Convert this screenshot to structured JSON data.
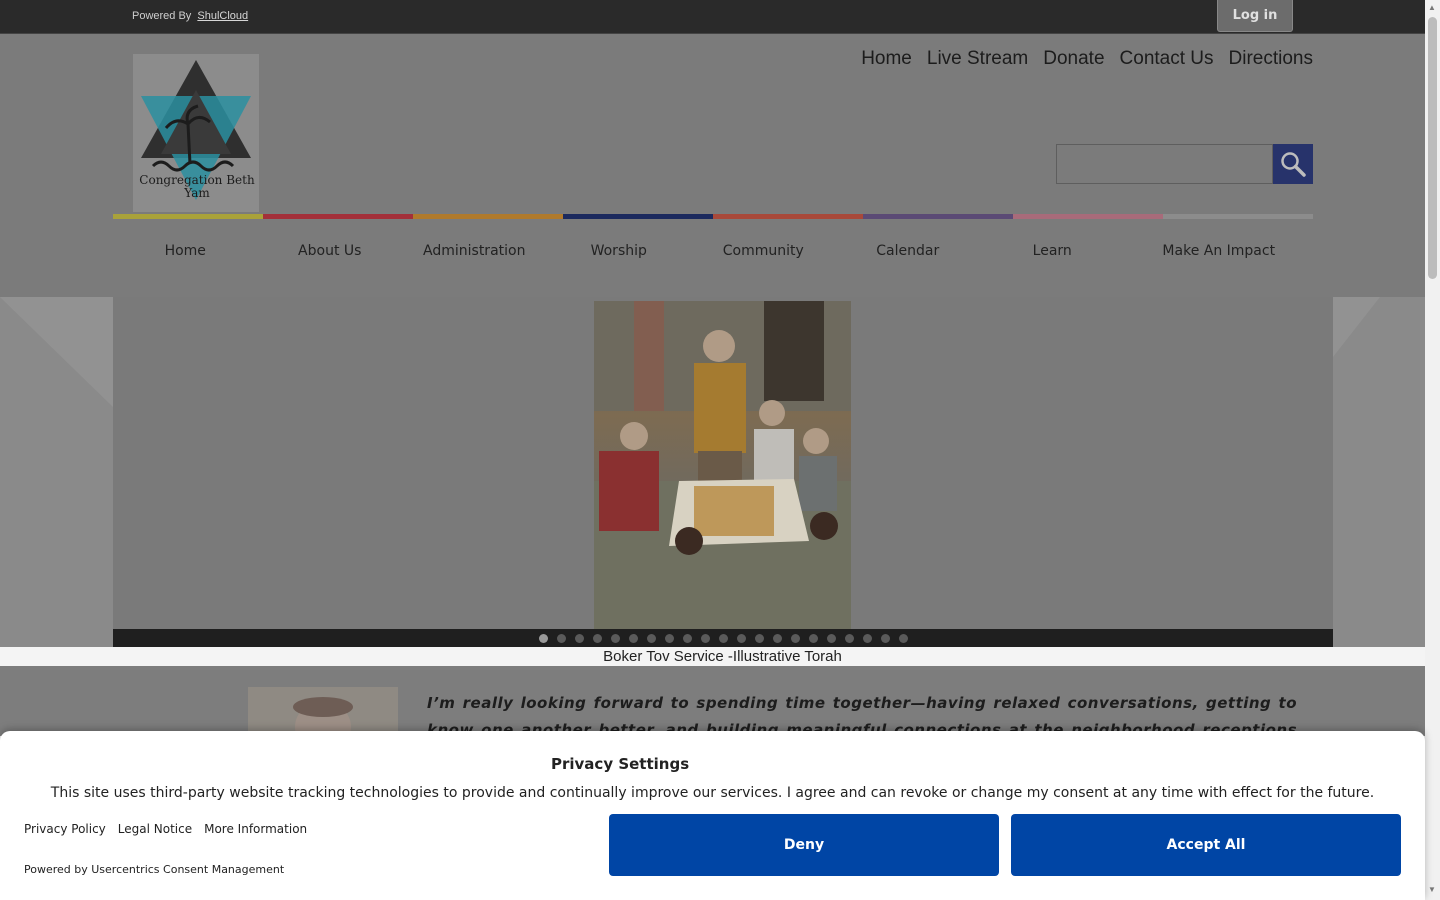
{
  "topbar": {
    "powered_prefix": "Powered By",
    "powered_link": "ShulCloud",
    "login_label": "Log in"
  },
  "logo": {
    "text": "Congregation Beth Yam"
  },
  "toplinks": [
    "Home",
    "Live Stream",
    "Donate",
    "Contact Us",
    "Directions"
  ],
  "search": {
    "placeholder": "",
    "icon": "search-icon"
  },
  "colorbar": [
    "#a9a23a",
    "#a3303a",
    "#b07a2c",
    "#1c2a5e",
    "#a8493a",
    "#5b4a75",
    "#a86b7a",
    "#8c8c8c"
  ],
  "mainnav": [
    "Home",
    "About Us",
    "Administration",
    "Worship",
    "Community",
    "Calendar",
    "Learn",
    "Make An Impact"
  ],
  "slider": {
    "caption": "Boker Tov Service -Illustrative Torah",
    "dot_count": 21,
    "active_dot": 0
  },
  "content": {
    "quote": "I’m really looking forward to spending time together—having relaxed conversations, getting to know one another better, and building meaningful connections at the neighborhood receptions our congregants are so"
  },
  "privacy": {
    "title": "Privacy Settings",
    "text": "This site uses third-party website tracking technologies to provide and continually improve our services. I agree and can revoke or change my consent at any time with effect for the future.",
    "links": [
      "Privacy Policy",
      "Legal Notice",
      "More Information"
    ],
    "powered": "Powered by Usercentrics Consent Management",
    "deny_label": "Deny",
    "accept_label": "Accept All",
    "button_color": "#0045a5"
  }
}
